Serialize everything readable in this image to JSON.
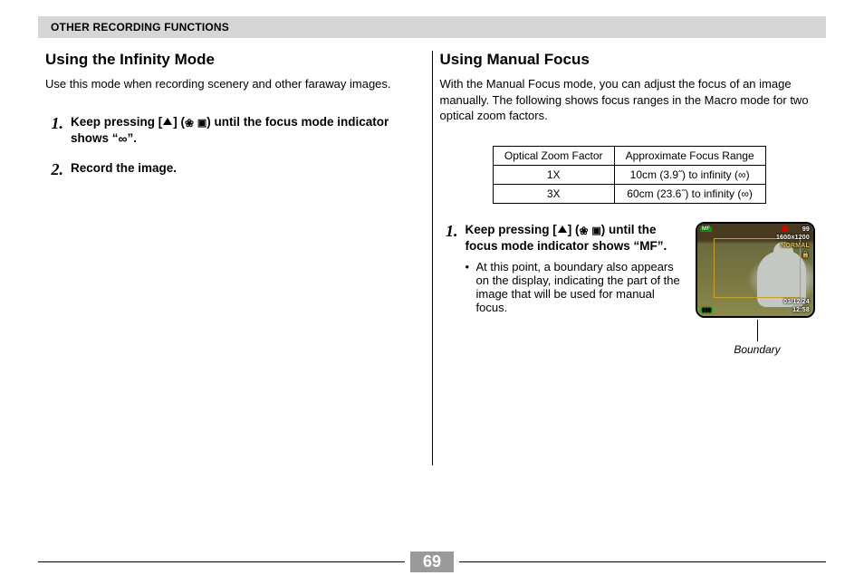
{
  "section_bar": "OTHER RECORDING FUNCTIONS",
  "left": {
    "heading": "Using the Infinity Mode",
    "intro": "Use this mode when recording scenery and other faraway images.",
    "step1_pre": "Keep pressing [",
    "step1_mid": "] (",
    "step1_post": ") until the focus mode indicator shows “",
    "step1_end": "”.",
    "step2": "Record the image."
  },
  "right": {
    "heading": "Using Manual Focus",
    "intro": "With the Manual Focus mode, you can adjust the focus of an image manually. The following shows focus ranges in the Macro mode for two optical zoom factors.",
    "table": {
      "h1": "Optical Zoom Factor",
      "h2": "Approximate Focus Range",
      "rows": [
        {
          "c1": "1X",
          "c2": "10cm (3.9˝) to infinity (∞)"
        },
        {
          "c1": "3X",
          "c2": "60cm (23.6˝) to infinity (∞)"
        }
      ]
    },
    "step1_pre": "Keep pressing [",
    "step1_mid": "] (",
    "step1_post": ") until the focus mode indicator shows “MF”.",
    "sub1": "At this point, a boundary also appears on the display, indicating the part of the image that will be used for manual focus.",
    "camera": {
      "mf": "MF",
      "n99": "99",
      "res": "1600×1200",
      "norm": "NORMAL",
      "date": "03/12/24",
      "time": "12:58",
      "lock": "🔒",
      "bat": "▮▮▮"
    },
    "caption": "Boundary"
  },
  "pageno": "69"
}
